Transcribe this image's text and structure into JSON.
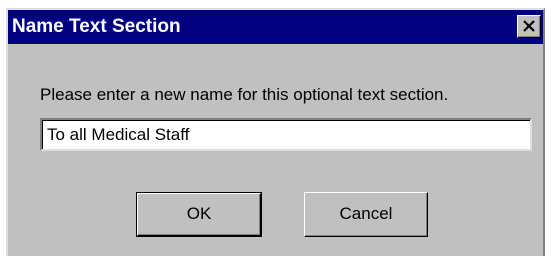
{
  "dialog": {
    "title": "Name Text Section",
    "close_icon": "close-x-icon",
    "prompt": "Please enter a new name for this optional text section.",
    "name_value": "To all Medical Staff",
    "ok_label": "OK",
    "cancel_label": "Cancel"
  },
  "colors": {
    "titlebar": "#000080",
    "face": "#c0c0c0"
  }
}
